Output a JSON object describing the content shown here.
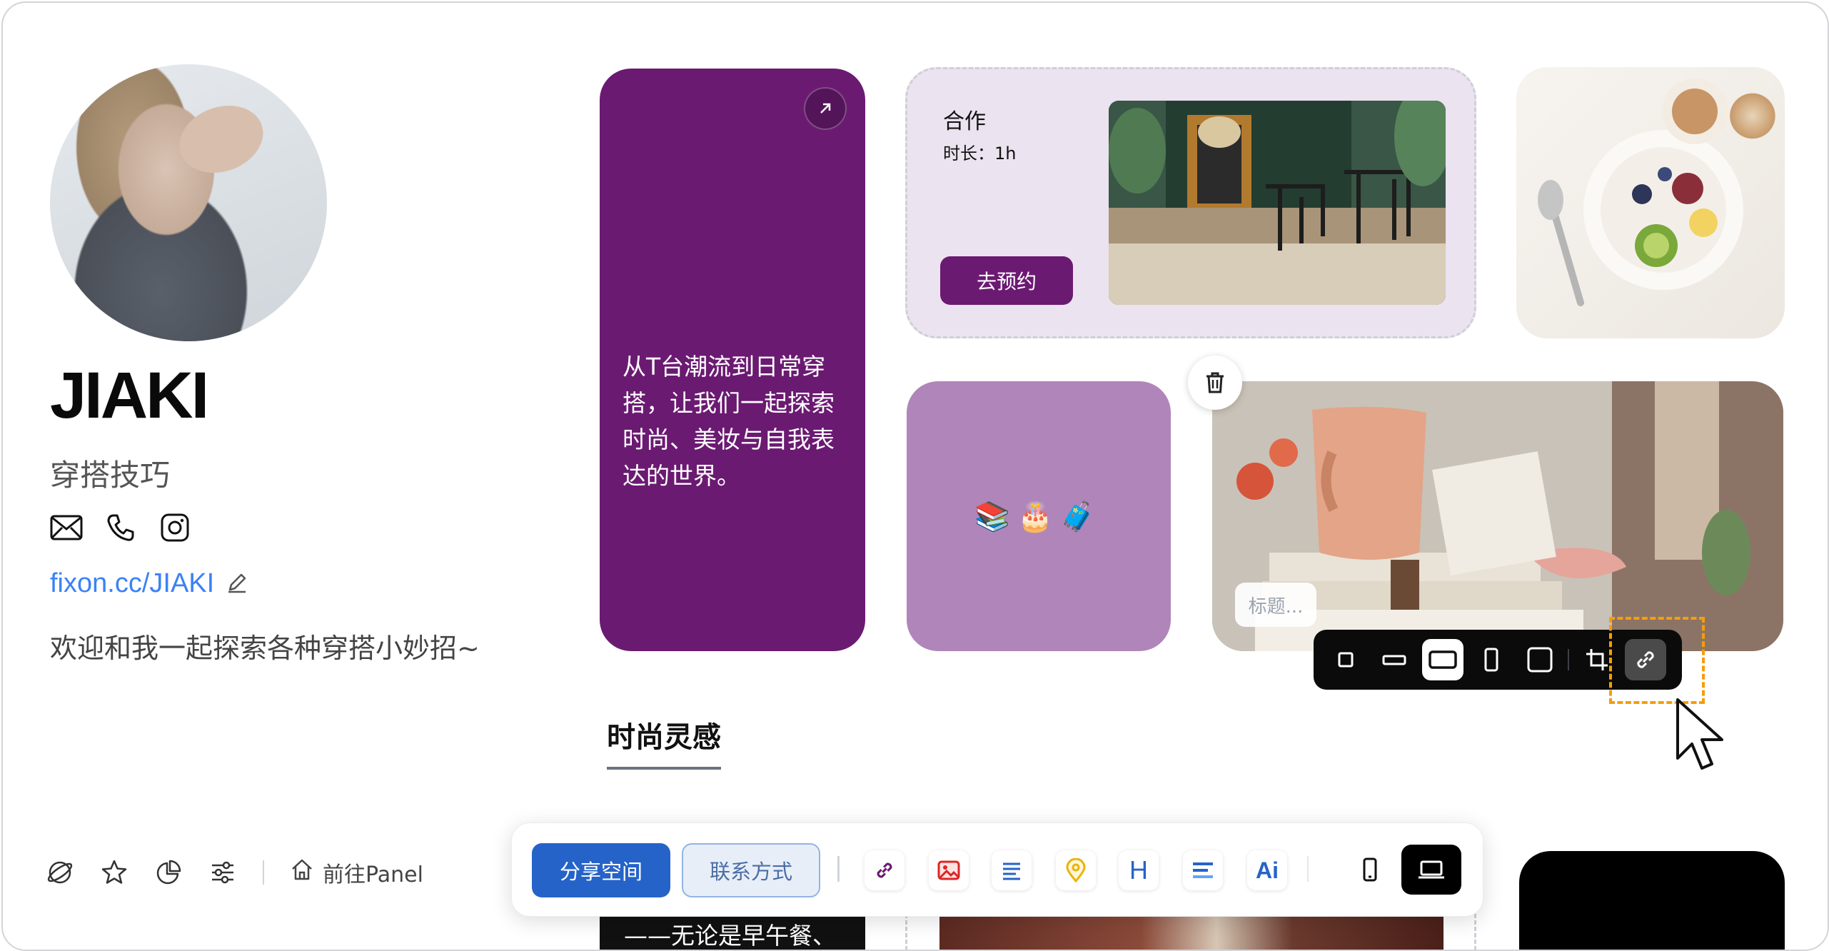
{
  "profile": {
    "name": "JIAKI",
    "subtitle": "穿搭技巧",
    "contact_icons": [
      "mail-icon",
      "phone-icon",
      "instagram-icon"
    ],
    "url": "fixon.cc/JIAKI",
    "bio": "欢迎和我一起探索各种穿搭小妙招~"
  },
  "sidebar_tools": {
    "icons": [
      "planet-icon",
      "star-icon",
      "pie-chart-icon",
      "sliders-icon"
    ],
    "panel_label": "前往Panel"
  },
  "cards": {
    "purple": {
      "text": "从T台潮流到日常穿搭，让我们一起探索时尚、美妆与自我表达的世界。",
      "bg": "#6b1a72"
    },
    "collab": {
      "title": "合作",
      "duration": "时长：1h",
      "button": "去预约",
      "bg": "#ebe3ef"
    },
    "emoji": {
      "emojis": "📚🎂🧳",
      "bg": "#b085b9"
    },
    "mug": {
      "title_placeholder": "标题..."
    }
  },
  "size_toolbar": {
    "options": [
      "size-small-square",
      "size-wide-short",
      "size-wide",
      "size-tall",
      "size-large-square",
      "crop",
      "link"
    ],
    "active": "size-wide"
  },
  "section": {
    "title": "时尚灵感"
  },
  "bottom_preview": {
    "text": "——无论是早午餐、"
  },
  "bottom_toolbar": {
    "share_label": "分享空间",
    "contact_label": "联系方式",
    "tools": [
      "link-icon",
      "image-icon",
      "text-icon",
      "map-pin-icon",
      "heading-icon",
      "note-icon",
      "ai-icon"
    ],
    "heading_glyph": "H",
    "ai_glyph": "Ai",
    "devices": [
      "mobile-icon",
      "desktop-icon"
    ],
    "active_device": "desktop"
  },
  "colors": {
    "accent_blue": "#2563c9",
    "link_blue": "#3b82f6",
    "highlight_orange": "#f59e0b"
  }
}
